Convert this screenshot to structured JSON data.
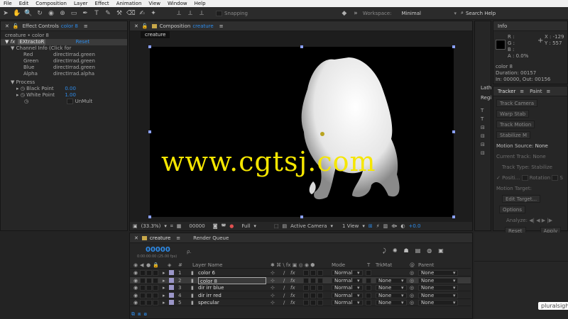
{
  "menu": [
    "File",
    "Edit",
    "Composition",
    "Layer",
    "Effect",
    "Animation",
    "View",
    "Window",
    "Help"
  ],
  "toolbar": {
    "snapping_label": "Snapping",
    "workspace_label": "Workspace:",
    "workspace_value": "Minimal",
    "search_placeholder": "Search Help"
  },
  "effect_controls": {
    "tab_prefix": "Effect Controls",
    "tab_layer": "color 8",
    "breadcrumb": "creature • color 8",
    "effect_name": "EXtractoR",
    "reset": "Reset",
    "channel_info": "Channel Info (Click for",
    "channels": [
      {
        "label": "Red",
        "value": "directIrrad.green"
      },
      {
        "label": "Green",
        "value": "directIrrad.green"
      },
      {
        "label": "Blue",
        "value": "directIrrad.green"
      },
      {
        "label": "Alpha",
        "value": "directIrrad.alpha"
      }
    ],
    "process": "Process",
    "black_point_label": "Black Point",
    "black_point_value": "0.00",
    "white_point_label": "White Point",
    "white_point_value": "1.00",
    "unmult": "UnMult"
  },
  "composition": {
    "tab_prefix": "Composition",
    "tab_name": "creature",
    "subtab": "creature",
    "watermark": "www.cgtsj.com",
    "zoom": "(33.3%)",
    "timecode": "00000",
    "resolution": "Full",
    "camera": "Active Camera",
    "views": "1 View",
    "exposure": "+0.0"
  },
  "info": {
    "title": "Info",
    "r": "R :",
    "g": "G :",
    "b": "B :",
    "a": "A : 0.0%",
    "x": "X : -129",
    "y": "Y : 557",
    "layer": "color 8",
    "duration": "Duration: 00157",
    "in_out": "In: 00000, Out: 00156"
  },
  "side_tabs": {
    "lath": "Lath",
    "regi": "Regi"
  },
  "tracker": {
    "tab_tracker": "Tracker",
    "tab_paint": "Paint",
    "track_camera": "Track Camera",
    "warp_stab": "Warp Stab",
    "track_motion": "Track Motion",
    "stabilize": "Stabilize M",
    "motion_source_label": "Motion Source:",
    "motion_source_value": "None",
    "current_track": "Current Track:",
    "current_track_value": "None",
    "track_type": "Track Type:",
    "track_type_value": "Stabilize",
    "position": "Positi...",
    "rotation": "Rotation",
    "scale": "S",
    "motion_target": "Motion Target:",
    "edit_target": "Edit Target...",
    "options": "Options",
    "analyze": "Analyze:",
    "reset": "Reset",
    "apply": "Apply"
  },
  "timeline": {
    "tab": "creature",
    "render_queue": "Render Queue",
    "timecode": "00000",
    "timecode_sub": "0:00:00:00 (25.00 fps)",
    "search_placeholder": "ρ.",
    "headers": {
      "num": "#",
      "name": "Layer Name",
      "mode": "Mode",
      "t": "T",
      "trkmat": "TrkMat",
      "parent": "Parent"
    },
    "layers": [
      {
        "num": "1",
        "name": "color 6",
        "mode": "Normal",
        "trkmat": "",
        "parent": "None"
      },
      {
        "num": "2",
        "name": "color 8",
        "mode": "Normal",
        "trkmat": "None",
        "parent": "None"
      },
      {
        "num": "3",
        "name": "dir irr blue",
        "mode": "Normal",
        "trkmat": "None",
        "parent": "None"
      },
      {
        "num": "4",
        "name": "dir irr red",
        "mode": "Normal",
        "trkmat": "None",
        "parent": "None"
      },
      {
        "num": "5",
        "name": "specular",
        "mode": "Normal",
        "trkmat": "None",
        "parent": "None"
      }
    ]
  },
  "branding": {
    "pluralsight": "pluralsight"
  },
  "colors": {
    "accent": "#2d8ceb",
    "watermark": "#f5e600",
    "layer_label": "#9b96c8"
  }
}
